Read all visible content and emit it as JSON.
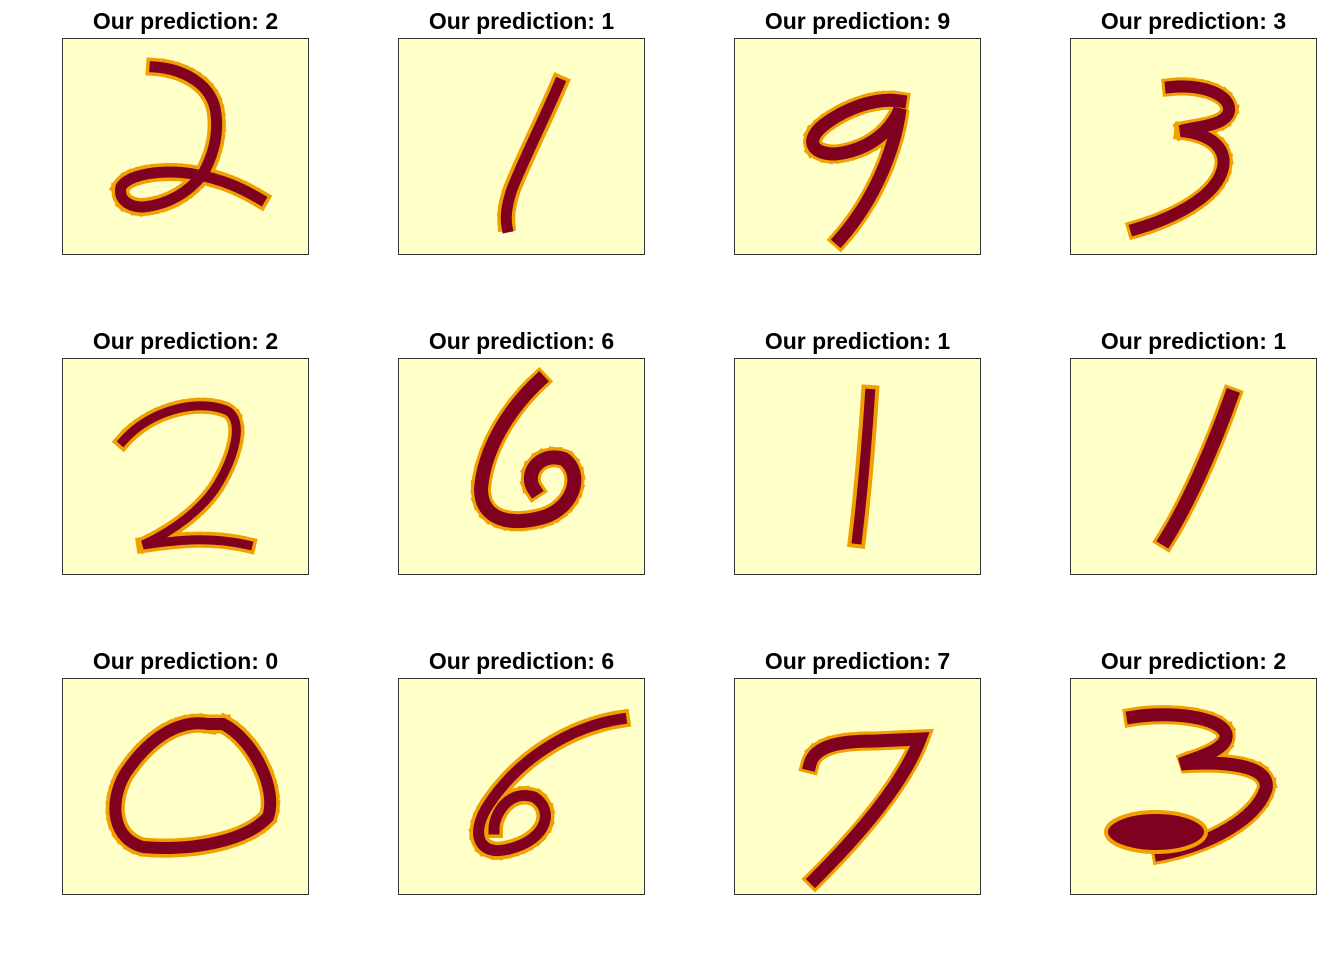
{
  "colors": {
    "background": "#ffffc8",
    "stroke": "#800020",
    "edge": "#f0a000",
    "edge_light": "#ffe090"
  },
  "panels": [
    {
      "title": "Our prediction: 2",
      "digit": "2"
    },
    {
      "title": "Our prediction: 1",
      "digit": "1"
    },
    {
      "title": "Our prediction: 9",
      "digit": "9"
    },
    {
      "title": "Our prediction: 3",
      "digit": "3"
    },
    {
      "title": "Our prediction: 2",
      "digit": "2"
    },
    {
      "title": "Our prediction: 6",
      "digit": "6"
    },
    {
      "title": "Our prediction: 1",
      "digit": "1"
    },
    {
      "title": "Our prediction: 1",
      "digit": "1"
    },
    {
      "title": "Our prediction: 0",
      "digit": "0"
    },
    {
      "title": "Our prediction: 6",
      "digit": "6"
    },
    {
      "title": "Our prediction: 7",
      "digit": "7"
    },
    {
      "title": "Our prediction: 2",
      "digit": "3"
    }
  ]
}
